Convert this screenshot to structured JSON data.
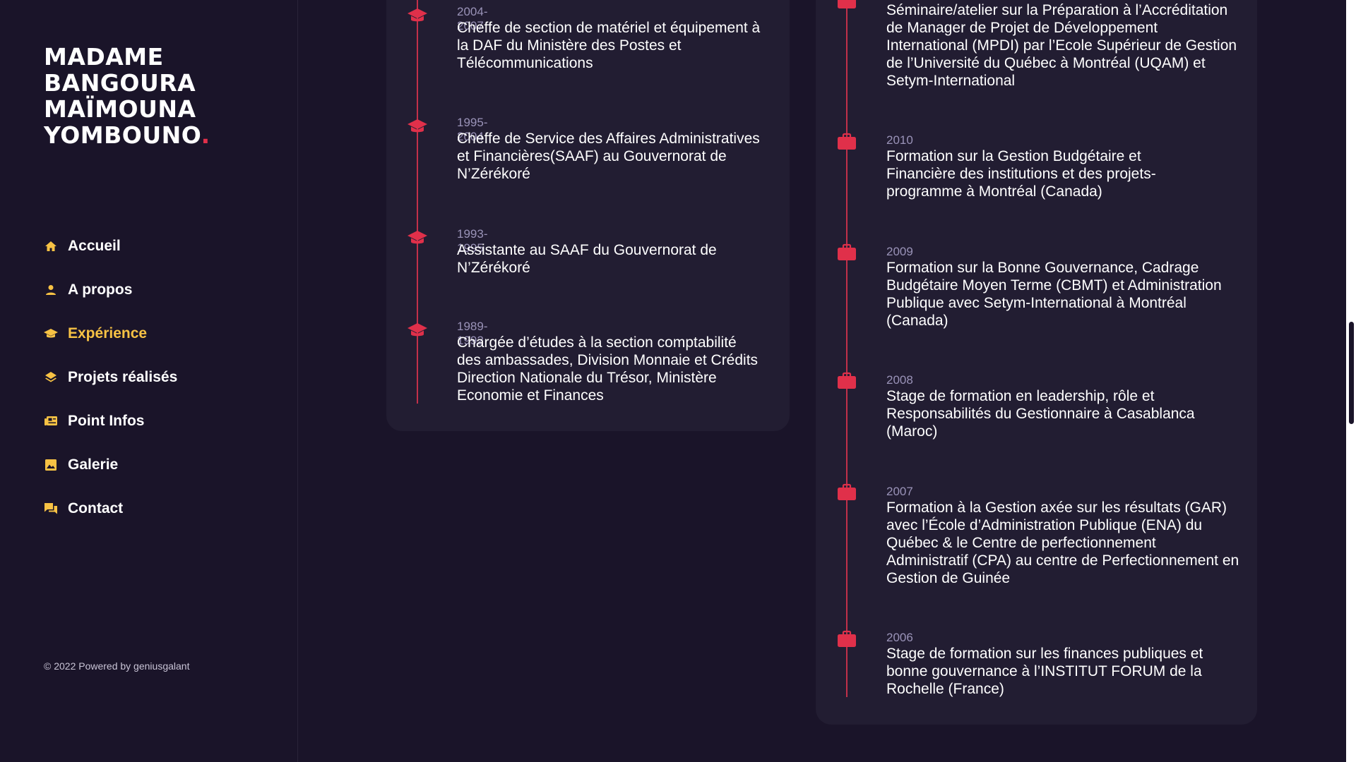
{
  "brand": {
    "lines": [
      "MADAME",
      "BANGOURA",
      "MAÏMOUNA",
      "YOMBOUNO"
    ],
    "dot": ".",
    "accent_color": "#e0304a"
  },
  "nav": {
    "active_color": "#f7c244",
    "items": [
      {
        "label": "Accueil",
        "icon": "home-icon"
      },
      {
        "label": "A propos",
        "icon": "user-icon"
      },
      {
        "label": "Expérience",
        "icon": "graduation-cap-icon",
        "active": true
      },
      {
        "label": "Projets réalisés",
        "icon": "layers-icon"
      },
      {
        "label": "Point Infos",
        "icon": "newspaper-icon"
      },
      {
        "label": "Galerie",
        "icon": "image-icon"
      },
      {
        "label": "Contact",
        "icon": "chat-icon"
      }
    ]
  },
  "footer": {
    "copyright": "© 2022 Powered by geniusgalant"
  },
  "experience": {
    "icon": "graduation-cap-icon",
    "items": [
      {
        "year": "2004-2007",
        "title": "Cheffe de section de matériel et équipement à la DAF du Ministère des Postes et Télécommunications"
      },
      {
        "year": "1995-2004",
        "title": "Cheffe de Service des Affaires Administratives et Financières(SAAF) au Gouvernorat de N’Zérékoré"
      },
      {
        "year": "1993-1995",
        "title": "Assistante au SAAF du Gouvernorat de N’Zérékoré"
      },
      {
        "year": "1989-1992",
        "title": "Chargée d’études à la section comptabilité des ambassades, Division Monnaie et Crédits Direction Nationale du Trésor, Ministère Economie et Finances"
      }
    ]
  },
  "training": {
    "icon": "briefcase-icon",
    "items": [
      {
        "year": "",
        "title": "Séminaire/atelier sur la Préparation à l’Accréditation de Manager de Projet de Développement International (MPDI) par l’Ecole Supérieur de Gestion de l’Université du Québec à Montréal (UQAM) et Setym-International"
      },
      {
        "year": "2010",
        "title": "Formation sur la Gestion Budgétaire et Financière des institutions et des projets-programme à Montréal (Canada)"
      },
      {
        "year": "2009",
        "title": "Formation sur la Bonne Gouvernance, Cadrage Budgétaire Moyen Terme (CBMT) et Administration Publique avec Setym-International à Montréal (Canada)"
      },
      {
        "year": "2008",
        "title": "Stage de formation en leadership, rôle et Responsabilités du Gestionnaire à Casablanca (Maroc)"
      },
      {
        "year": "2007",
        "title": "Formation à la Gestion axée sur les résultats (GAR) avec l’École d’Administration Publique (ENA) du Québec & le Centre de perfectionnement Administratif (CPA) au centre de Perfectionnement en Gestion de Guinée"
      },
      {
        "year": "2006",
        "title": "Stage de formation sur les finances publiques et bonne gouvernance à l’INSTITUT FORUM de la Rochelle (France)"
      }
    ]
  }
}
